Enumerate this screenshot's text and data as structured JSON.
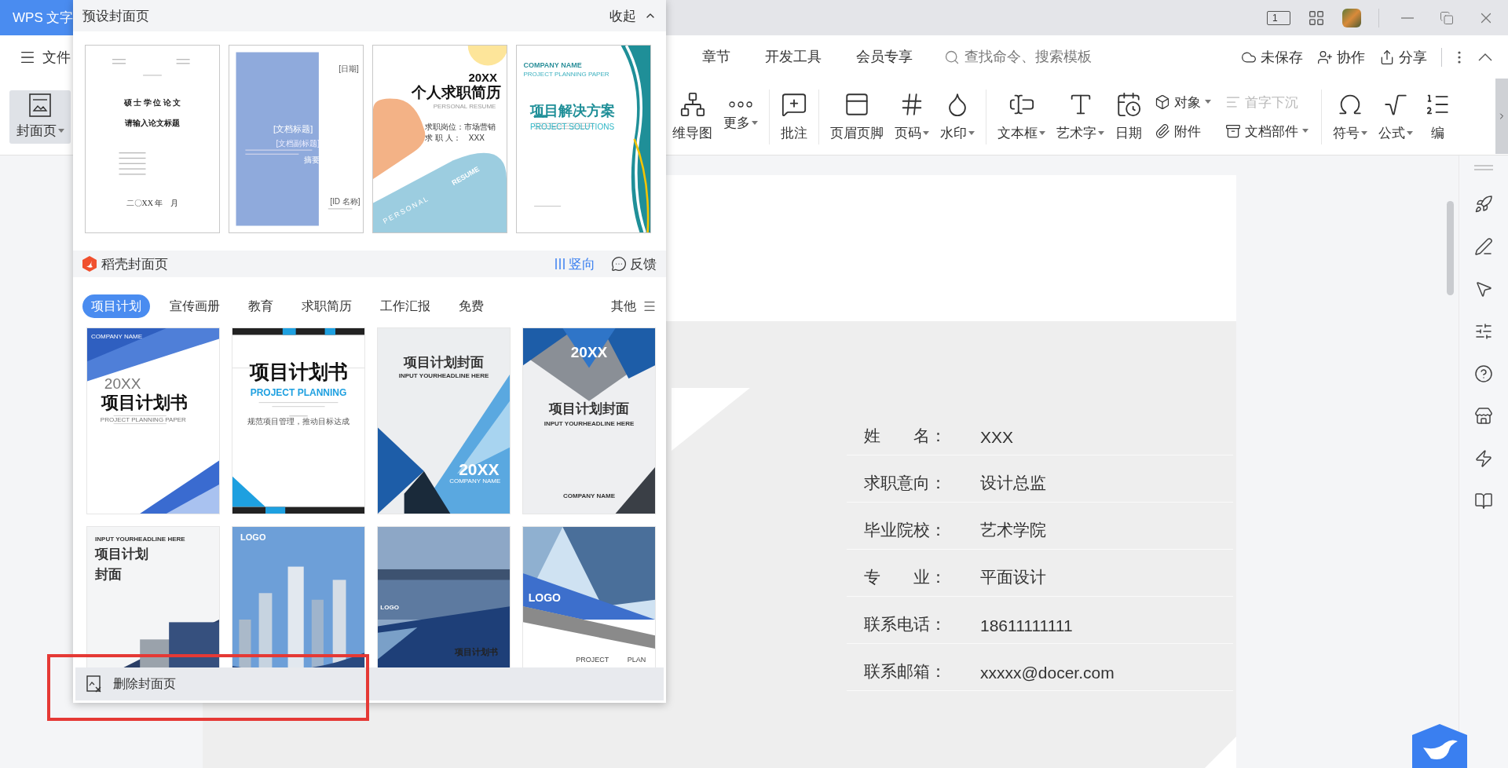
{
  "title_bar": {
    "app_tab": "WPS 文字",
    "page_count": "1"
  },
  "menu": {
    "file": "文件",
    "tabs": [
      {
        "label": "章节",
        "selected": false
      },
      {
        "label": "开发工具",
        "selected": false
      },
      {
        "label": "会员专享",
        "selected": false
      }
    ],
    "search": {
      "placeholder": "查找命令、搜索模板"
    },
    "actions": [
      {
        "label": "未保存"
      },
      {
        "label": "协作"
      },
      {
        "label": "分享"
      }
    ]
  },
  "ribbon": {
    "cover_button": {
      "label": "封面页",
      "selected": true,
      "dropdown": true
    },
    "items": [
      {
        "kind": "large",
        "label": "维导图",
        "dropdown": false,
        "disabled": false
      },
      {
        "kind": "large",
        "label": "更多",
        "dropdown": true,
        "disabled": false
      },
      {
        "kind": "separator"
      },
      {
        "kind": "large",
        "label": "批注",
        "dropdown": false,
        "disabled": false
      },
      {
        "kind": "separator"
      },
      {
        "kind": "large",
        "label": "页眉页脚",
        "dropdown": false,
        "disabled": false
      },
      {
        "kind": "large",
        "label": "页码",
        "dropdown": true,
        "disabled": false
      },
      {
        "kind": "large",
        "label": "水印",
        "dropdown": true,
        "disabled": false
      },
      {
        "kind": "separator"
      },
      {
        "kind": "large",
        "label": "文本框",
        "dropdown": true,
        "disabled": false
      },
      {
        "kind": "large",
        "label": "艺术字",
        "dropdown": true,
        "disabled": false
      },
      {
        "kind": "large",
        "label": "日期",
        "dropdown": false,
        "disabled": false
      },
      {
        "kind": "stack",
        "entries": [
          {
            "label": "对象",
            "dropdown": true,
            "disabled": false
          },
          {
            "label": "附件",
            "dropdown": false,
            "disabled": false
          }
        ]
      },
      {
        "kind": "stack",
        "entries": [
          {
            "label": "首字下沉",
            "dropdown": false,
            "disabled": true
          },
          {
            "label": "文档部件",
            "dropdown": true,
            "disabled": false
          }
        ]
      },
      {
        "kind": "separator"
      },
      {
        "kind": "large",
        "label": "符号",
        "dropdown": true,
        "disabled": false
      },
      {
        "kind": "large",
        "label": "公式",
        "dropdown": true,
        "disabled": false
      },
      {
        "kind": "large",
        "label": "编",
        "dropdown": false,
        "disabled": false
      }
    ]
  },
  "document": {
    "rows": [
      {
        "label": "姓　　名：",
        "value": "XXX"
      },
      {
        "label": "求职意向：",
        "value": "设计总监"
      },
      {
        "label": "毕业院校：",
        "value": "艺术学院"
      },
      {
        "label": "专　　业：",
        "value": "平面设计"
      },
      {
        "label": "联系电话：",
        "value": "18611111111"
      },
      {
        "label": "联系邮箱：",
        "value": "xxxxx@docer.com"
      }
    ]
  },
  "panel": {
    "title": "预设封面页",
    "collapse": "收起",
    "presets": [
      {
        "kind": "thesis",
        "texts": [
          "硕 士 学 位 论 文",
          "请输入论文标题",
          "二〇XX 年　月"
        ]
      },
      {
        "kind": "block",
        "texts": [
          "[日期]",
          "[文档标题]",
          "[文档副标题]",
          "摘要",
          "[ID 名称]"
        ]
      },
      {
        "kind": "resume",
        "texts": [
          "20XX",
          "个人求职简历",
          "PERSONAL RESUME",
          "求职岗位：市场营销",
          "求 职 人：　XXX",
          "PERSONAL",
          "RESUME"
        ]
      },
      {
        "kind": "solution",
        "texts": [
          "COMPANY NAME",
          "PROJECT PLANNING PAPER",
          "项目解决方案",
          "PROJECT SOLUTIONS"
        ]
      }
    ],
    "docer": {
      "title": "稻壳封面页",
      "orientation": "竖向",
      "feedback": "反馈"
    },
    "tabs": [
      {
        "label": "项目计划",
        "selected": true
      },
      {
        "label": "宣传画册",
        "selected": false
      },
      {
        "label": "教育",
        "selected": false
      },
      {
        "label": "求职简历",
        "selected": false
      },
      {
        "label": "工作汇报",
        "selected": false
      },
      {
        "label": "免费",
        "selected": false
      }
    ],
    "other": "其他",
    "templates": [
      {
        "kind": "wave",
        "texts": [
          "COMPANY NAME",
          "20XX",
          "项目计划书",
          "PROJECT PLANNING PAPER"
        ]
      },
      {
        "kind": "stripe",
        "texts": [
          "项目计划书",
          "PROJECT PLANNING",
          "规范项目管理，推动目标达成"
        ]
      },
      {
        "kind": "diagonal",
        "texts": [
          "项目计划封面",
          "INPUT YOURHEADLINE HERE",
          "20XX",
          "COMPANY NAME"
        ]
      },
      {
        "kind": "citytop",
        "texts": [
          "20XX",
          "项目计划封面",
          "INPUT YOURHEADLINE HERE",
          "COMPANY NAME"
        ]
      },
      {
        "kind": "building",
        "texts": [
          "INPUT YOURHEADLINE HERE",
          "项目计划",
          "封面"
        ]
      },
      {
        "kind": "skyline",
        "texts": [
          "LOGO"
        ]
      },
      {
        "kind": "lake",
        "texts": [
          "LOGO",
          "项目计划书"
        ]
      },
      {
        "kind": "glass",
        "texts": [
          "LOGO",
          "PROJECT",
          "PLAN"
        ]
      }
    ],
    "delete_button": "删除封面页"
  },
  "annotation": {
    "kind": "frame"
  }
}
